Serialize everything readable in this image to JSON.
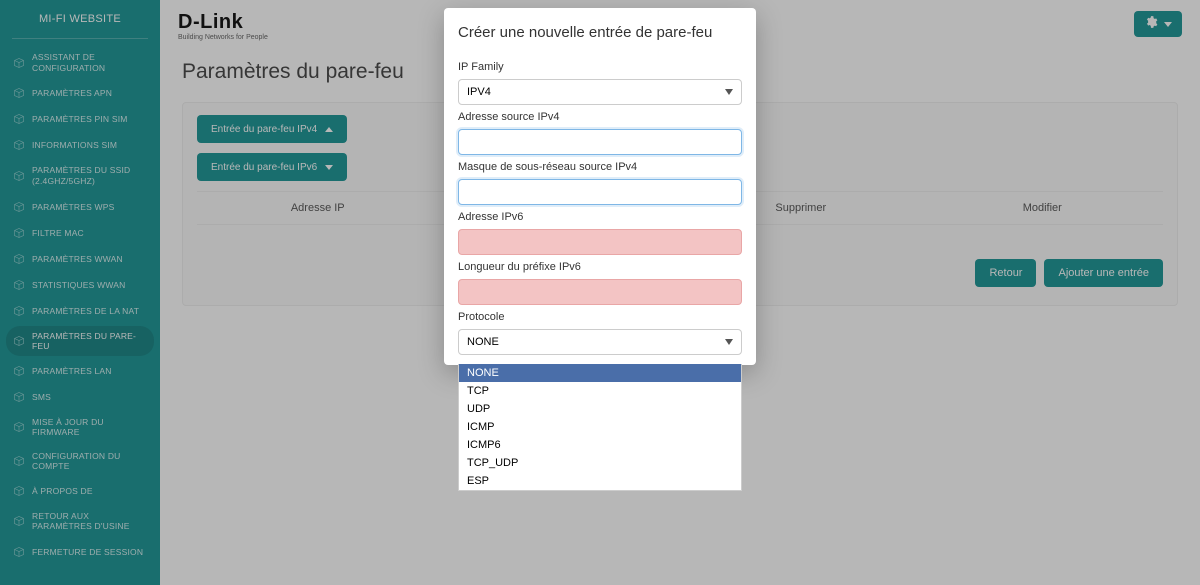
{
  "sidebar": {
    "title": "MI-FI WEBSITE",
    "items": [
      {
        "label": "ASSISTANT DE CONFIGURATION"
      },
      {
        "label": "PARAMÈTRES APN"
      },
      {
        "label": "PARAMÈTRES PIN SIM"
      },
      {
        "label": "INFORMATIONS SIM"
      },
      {
        "label": "PARAMÈTRES DU SSID (2.4GHZ/5GHZ)"
      },
      {
        "label": "PARAMÈTRES WPS"
      },
      {
        "label": "FILTRE MAC"
      },
      {
        "label": "PARAMÈTRES WWAN"
      },
      {
        "label": "STATISTIQUES WWAN"
      },
      {
        "label": "PARAMÈTRES DE LA NAT"
      },
      {
        "label": "PARAMÈTRES DU PARE-FEU"
      },
      {
        "label": "PARAMÈTRES LAN"
      },
      {
        "label": "SMS"
      },
      {
        "label": "MISE À JOUR DU FIRMWARE"
      },
      {
        "label": "CONFIGURATION DU COMPTE"
      },
      {
        "label": "À PROPOS DE"
      },
      {
        "label": "RETOUR AUX PARAMÈTRES D'USINE"
      },
      {
        "label": "FERMETURE DE SESSION"
      }
    ],
    "active_index": 10
  },
  "brand": {
    "name": "D-Link",
    "tagline": "Building Networks for People"
  },
  "page": {
    "title": "Paramètres du pare-feu",
    "chip_ipv4": "Entrée du pare-feu IPv4",
    "chip_ipv6": "Entrée du pare-feu IPv6",
    "columns": [
      "Adresse IP",
      "",
      "Supprimer",
      "Modifier"
    ],
    "btn_back": "Retour",
    "btn_add": "Ajouter une entrée"
  },
  "modal": {
    "title": "Créer une nouvelle entrée de pare-feu",
    "labels": {
      "ip_family": "IP Family",
      "src_ipv4": "Adresse source IPv4",
      "src_ipv4_mask": "Masque de sous-réseau source IPv4",
      "ipv6_addr": "Adresse IPv6",
      "ipv6_prefix": "Longueur du préfixe IPv6",
      "protocol": "Protocole"
    },
    "ip_family_value": "IPV4",
    "protocol_value": "NONE",
    "protocol_options": [
      "NONE",
      "TCP",
      "UDP",
      "ICMP",
      "ICMP6",
      "TCP_UDP",
      "ESP"
    ]
  }
}
